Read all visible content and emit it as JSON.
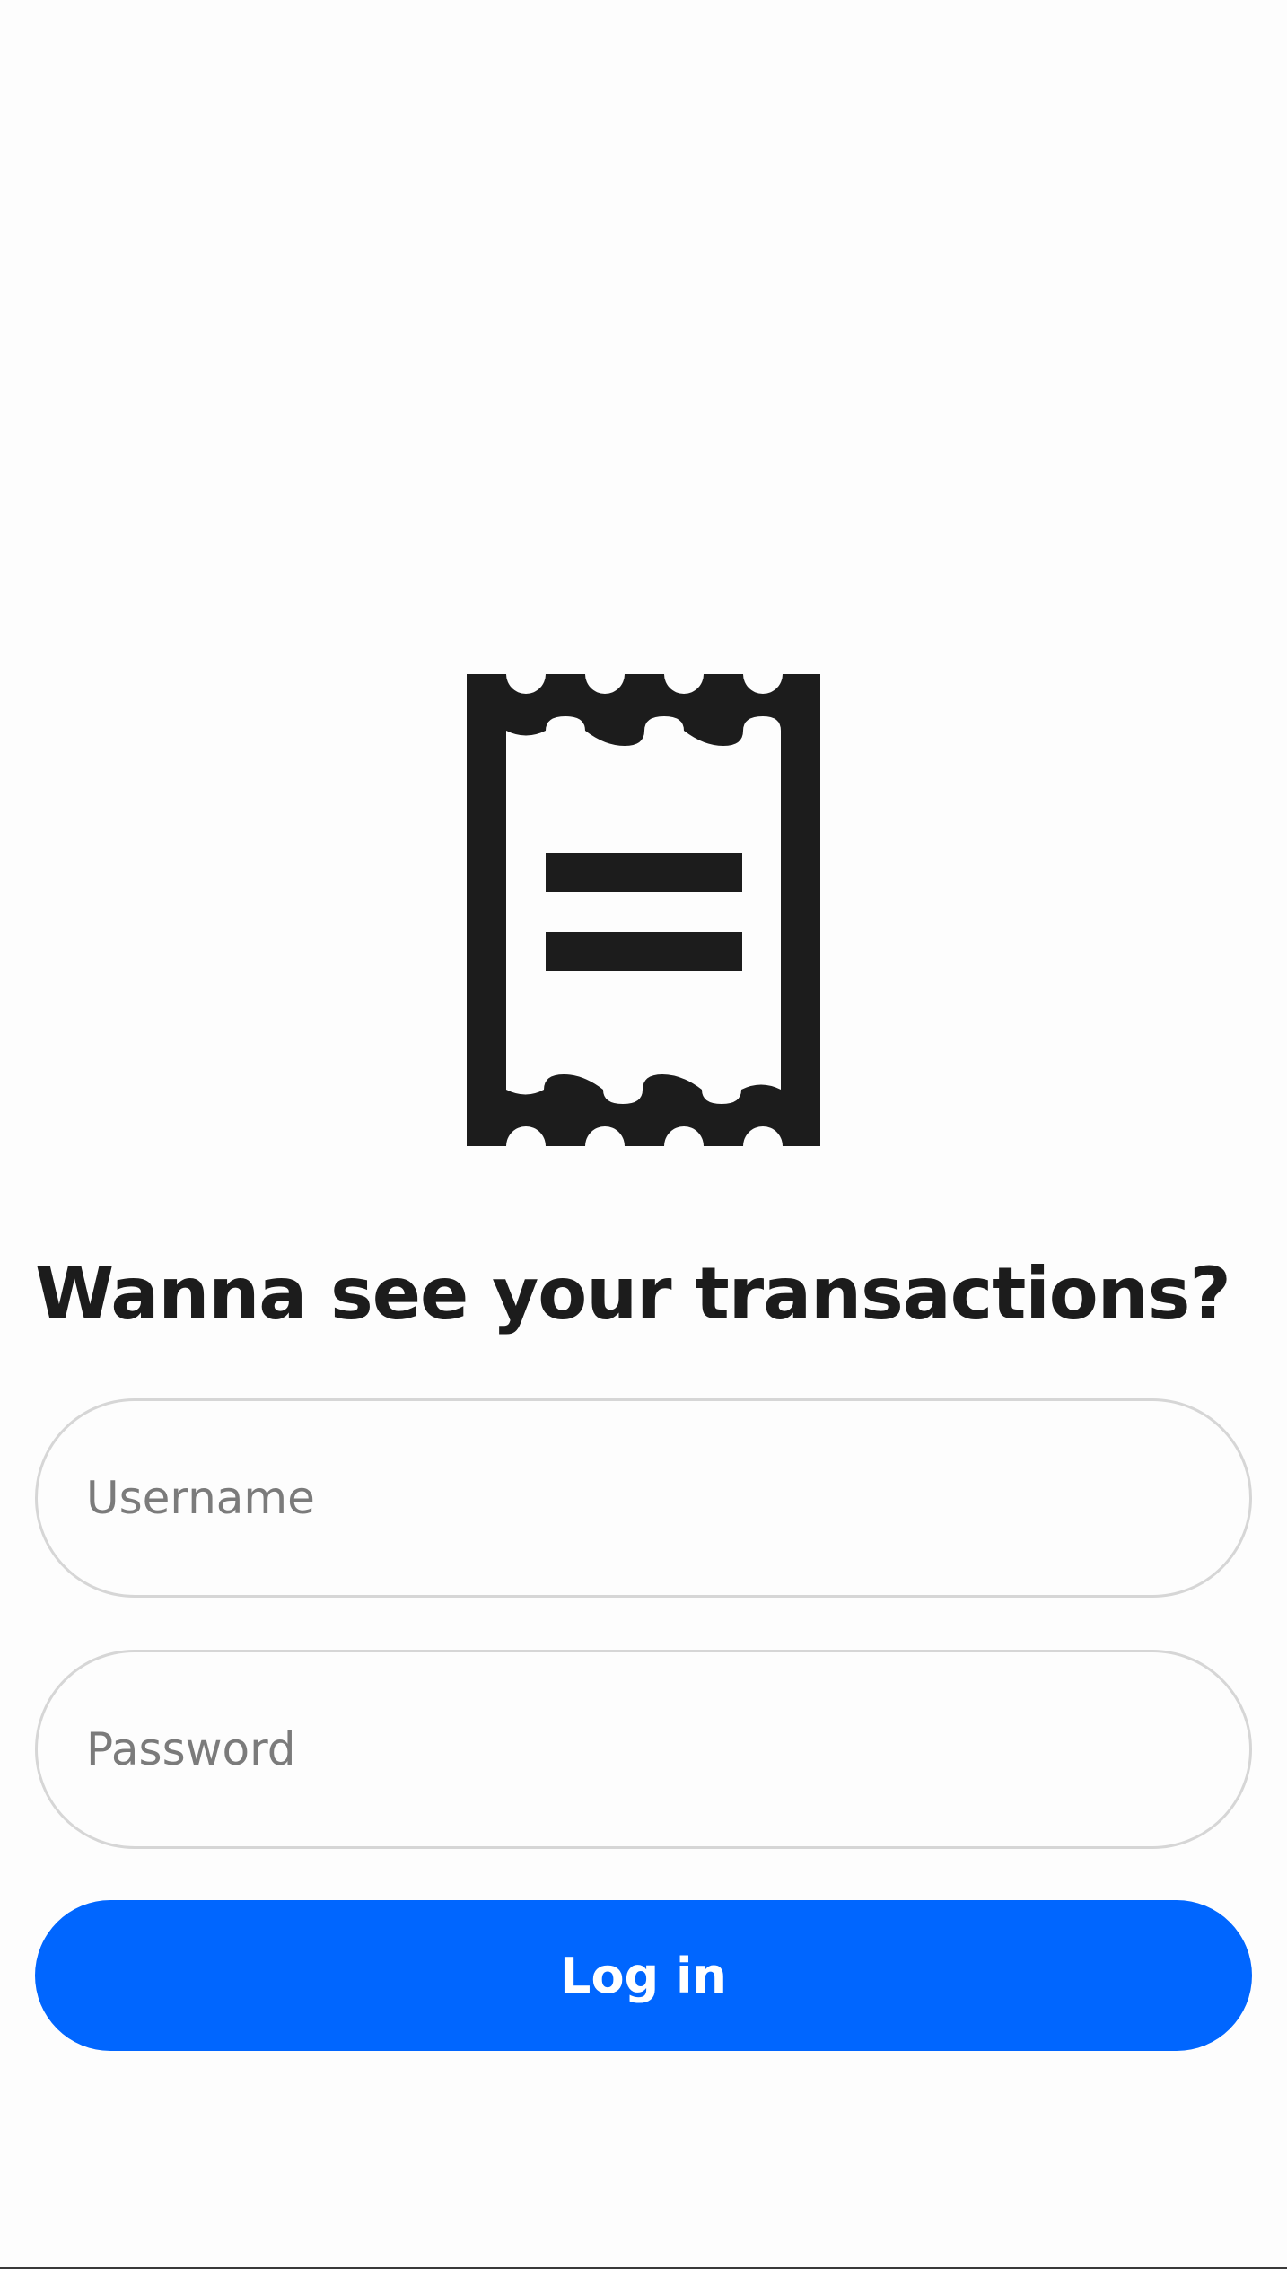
{
  "heading": "Wanna see your transactions?",
  "icons": {
    "hero": "receipt-icon"
  },
  "form": {
    "username_placeholder": "Username",
    "password_placeholder": "Password",
    "login_label": "Log in"
  },
  "colors": {
    "accent": "#0066ff",
    "text": "#1c1c1c",
    "placeholder": "#7b7b7b",
    "field_border": "#d6d6d6",
    "background": "#fdfdfd"
  }
}
